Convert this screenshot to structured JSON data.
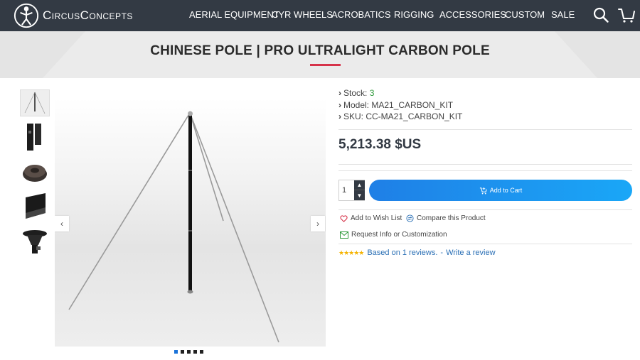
{
  "brand": {
    "name": "CircusConcepts"
  },
  "nav": {
    "items": [
      "AERIAL EQUIPMENT",
      "CYR WHEELS",
      "ACROBATICS",
      "RIGGING",
      "ACCESSORIES",
      "CUSTOM",
      "SALE"
    ]
  },
  "header_icons": [
    "search-icon",
    "cart-icon"
  ],
  "hero": {
    "title": "CHINESE POLE | PRO ULTRALIGHT CARBON POLE"
  },
  "gallery": {
    "thumbnails": [
      "pole-tripod",
      "pole-sections",
      "base-plate",
      "pole-segment",
      "top-mount"
    ],
    "active_slide": 1,
    "slide_count": 5
  },
  "product": {
    "stock_label": "Stock:",
    "stock_value": "3",
    "model": "Model: MA21_CARBON_KIT",
    "sku": "SKU: CC-MA21_CARBON_KIT",
    "price": "5,213.38 $US",
    "quantity": "1",
    "add_to_cart": "Add to Cart",
    "wishlist": "Add to Wish List",
    "compare": "Compare this Product",
    "request": "Request Info or Customization",
    "rating": 5,
    "reviews_text": "Based on 1 reviews.",
    "separator": "-",
    "write_review": "Write a review"
  },
  "colors": {
    "topbar": "#333a44",
    "accent": "#d6334a",
    "button": "#1f7fe6",
    "stock": "#2e9a3a",
    "link": "#2a6fb5",
    "star": "#f5b301"
  }
}
